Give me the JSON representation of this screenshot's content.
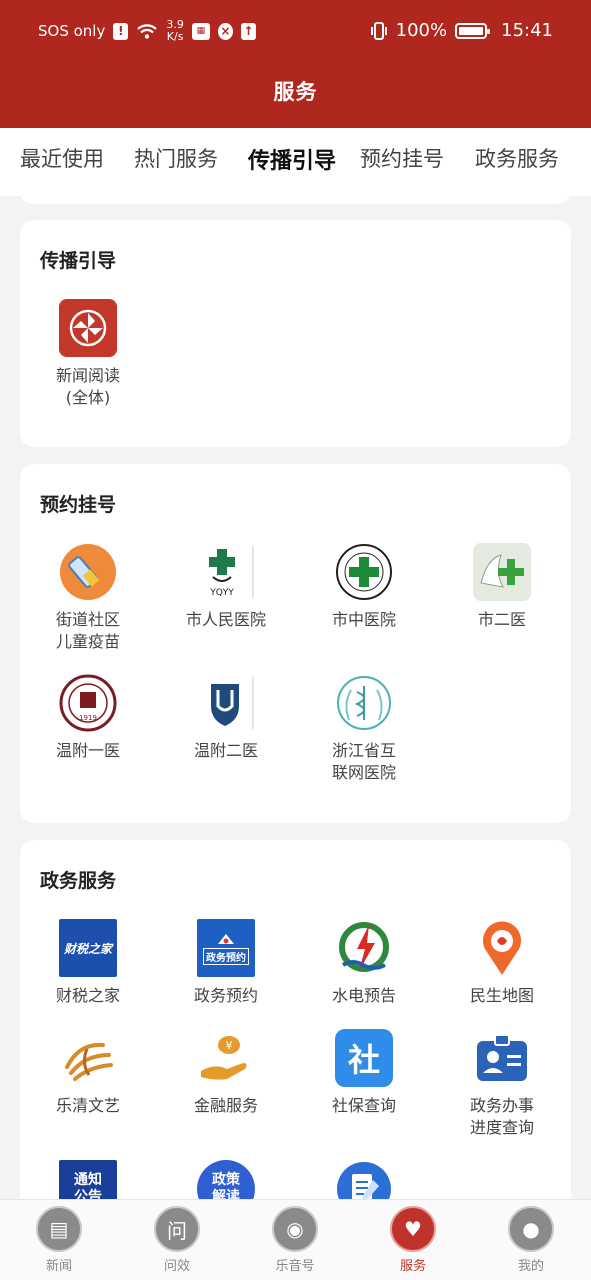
{
  "status_bar": {
    "carrier": "SOS only",
    "net_speed_value": "3.9",
    "net_speed_unit": "K/s",
    "battery": "100%",
    "time": "15:41"
  },
  "header": {
    "title": "服务"
  },
  "tabs": {
    "items": [
      "最近使用",
      "热门服务",
      "传播引导",
      "预约挂号",
      "政务服务"
    ],
    "active": "传播引导"
  },
  "sections": {
    "guidance": {
      "title": "传播引导",
      "items": [
        {
          "label": "新闻阅读\n(全体)",
          "icon": "pinwheel-icon"
        }
      ]
    },
    "appointments": {
      "title": "预约挂号",
      "items": [
        {
          "label": "街道社区\n儿童疫苗",
          "icon": "vaccine-icon"
        },
        {
          "label": "市人民医院",
          "icon": "yqyy-hospital-icon"
        },
        {
          "label": "市中医院",
          "icon": "tcm-hospital-icon"
        },
        {
          "label": "市二医",
          "icon": "second-hospital-icon"
        },
        {
          "label": "温附一医",
          "icon": "wenfu-first-icon"
        },
        {
          "label": "温附二医",
          "icon": "wenfu-second-icon"
        },
        {
          "label": "浙江省互\n联网医院",
          "icon": "internet-hospital-icon"
        }
      ]
    },
    "government": {
      "title": "政务服务",
      "items": [
        {
          "label": "财税之家",
          "icon": "tax-home-icon",
          "icon_text": "财税之家"
        },
        {
          "label": "政务预约",
          "icon": "gov-appointment-icon",
          "icon_text": "政务预约"
        },
        {
          "label": "水电预告",
          "icon": "water-power-icon"
        },
        {
          "label": "民生地图",
          "icon": "map-pin-icon"
        },
        {
          "label": "乐清文艺",
          "icon": "yueqing-art-icon"
        },
        {
          "label": "金融服务",
          "icon": "finance-icon"
        },
        {
          "label": "社保查询",
          "icon": "social-security-icon",
          "icon_text": "社"
        },
        {
          "label": "政务办事\n进度查询",
          "icon": "progress-query-icon"
        },
        {
          "label": "",
          "icon": "notice-icon",
          "icon_text": "通知公告"
        },
        {
          "label": "",
          "icon": "policy-icon",
          "icon_text": "政策解读"
        },
        {
          "label": "",
          "icon": "document-pen-icon"
        }
      ]
    }
  },
  "bottom_nav": {
    "items": [
      {
        "label": "新闻",
        "icon": "news-icon",
        "glyph": "▤"
      },
      {
        "label": "问效",
        "icon": "question-icon",
        "glyph": "问"
      },
      {
        "label": "乐音号",
        "icon": "satellite-icon",
        "glyph": "◉"
      },
      {
        "label": "服务",
        "icon": "heart-hands-icon",
        "glyph": "♥"
      },
      {
        "label": "我的",
        "icon": "profile-icon",
        "glyph": "●"
      }
    ],
    "active": "服务"
  },
  "colors": {
    "brand_red": "#b0271f",
    "background": "#f3f3f3",
    "card": "#ffffff"
  }
}
